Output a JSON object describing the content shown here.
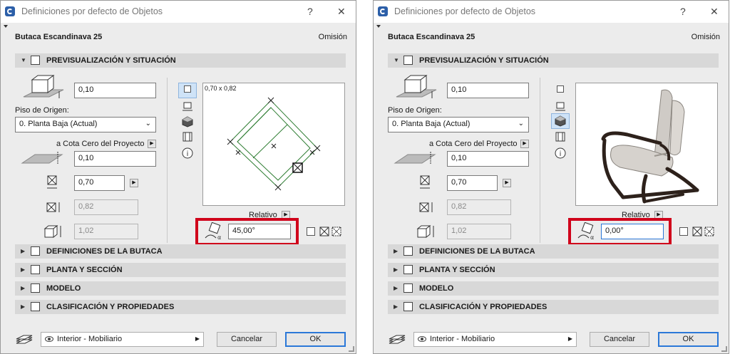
{
  "panels": [
    {
      "id": "left",
      "title": "Definiciones por defecto de Objetos",
      "help": "?",
      "close": "✕",
      "object_name": "Butaca Escandinava 25",
      "default_label": "Omisión",
      "sections": {
        "preview": "PREVISUALIZACIÓN Y SITUACIÓN",
        "chair": "DEFINICIONES DE LA BUTACA",
        "plan": "PLANTA Y SECCIÓN",
        "model": "MODELO",
        "classification": "CLASIFICACIÓN Y PROPIEDADES"
      },
      "height_value": "0,10",
      "story_label": "Piso de Origen:",
      "story_value": "0. Planta Baja (Actual)",
      "elevation_label": "a Cota Cero del Proyecto",
      "elevation_value": "0,10",
      "width_value": "0,70",
      "length_value": "0,82",
      "height3_value": "1,02",
      "preview_size": "0,70 x 0,82",
      "relative_label": "Relativo",
      "angle_value": "45,00°",
      "preview_mode": "plan",
      "layer_value": "Interior - Mobiliario",
      "cancel_label": "Cancelar",
      "ok_label": "OK"
    },
    {
      "id": "right",
      "title": "Definiciones por defecto de Objetos",
      "help": "?",
      "close": "✕",
      "object_name": "Butaca Escandinava 25",
      "default_label": "Omisión",
      "sections": {
        "preview": "PREVISUALIZACIÓN Y SITUACIÓN",
        "chair": "DEFINICIONES DE LA BUTACA",
        "plan": "PLANTA Y SECCIÓN",
        "model": "MODELO",
        "classification": "CLASIFICACIÓN Y PROPIEDADES"
      },
      "height_value": "0,10",
      "story_label": "Piso de Origen:",
      "story_value": "0. Planta Baja (Actual)",
      "elevation_label": "a Cota Cero del Proyecto",
      "elevation_value": "0,10",
      "width_value": "0,70",
      "length_value": "0,82",
      "height3_value": "1,02",
      "relative_label": "Relativo",
      "angle_value": "0,00°",
      "preview_mode": "3d",
      "layer_value": "Interior - Mobiliario",
      "cancel_label": "Cancelar",
      "ok_label": "OK"
    }
  ],
  "colors": {
    "highlight": "#d0021b",
    "accent": "#2b78d8",
    "section_bg": "#d8d8d8"
  }
}
